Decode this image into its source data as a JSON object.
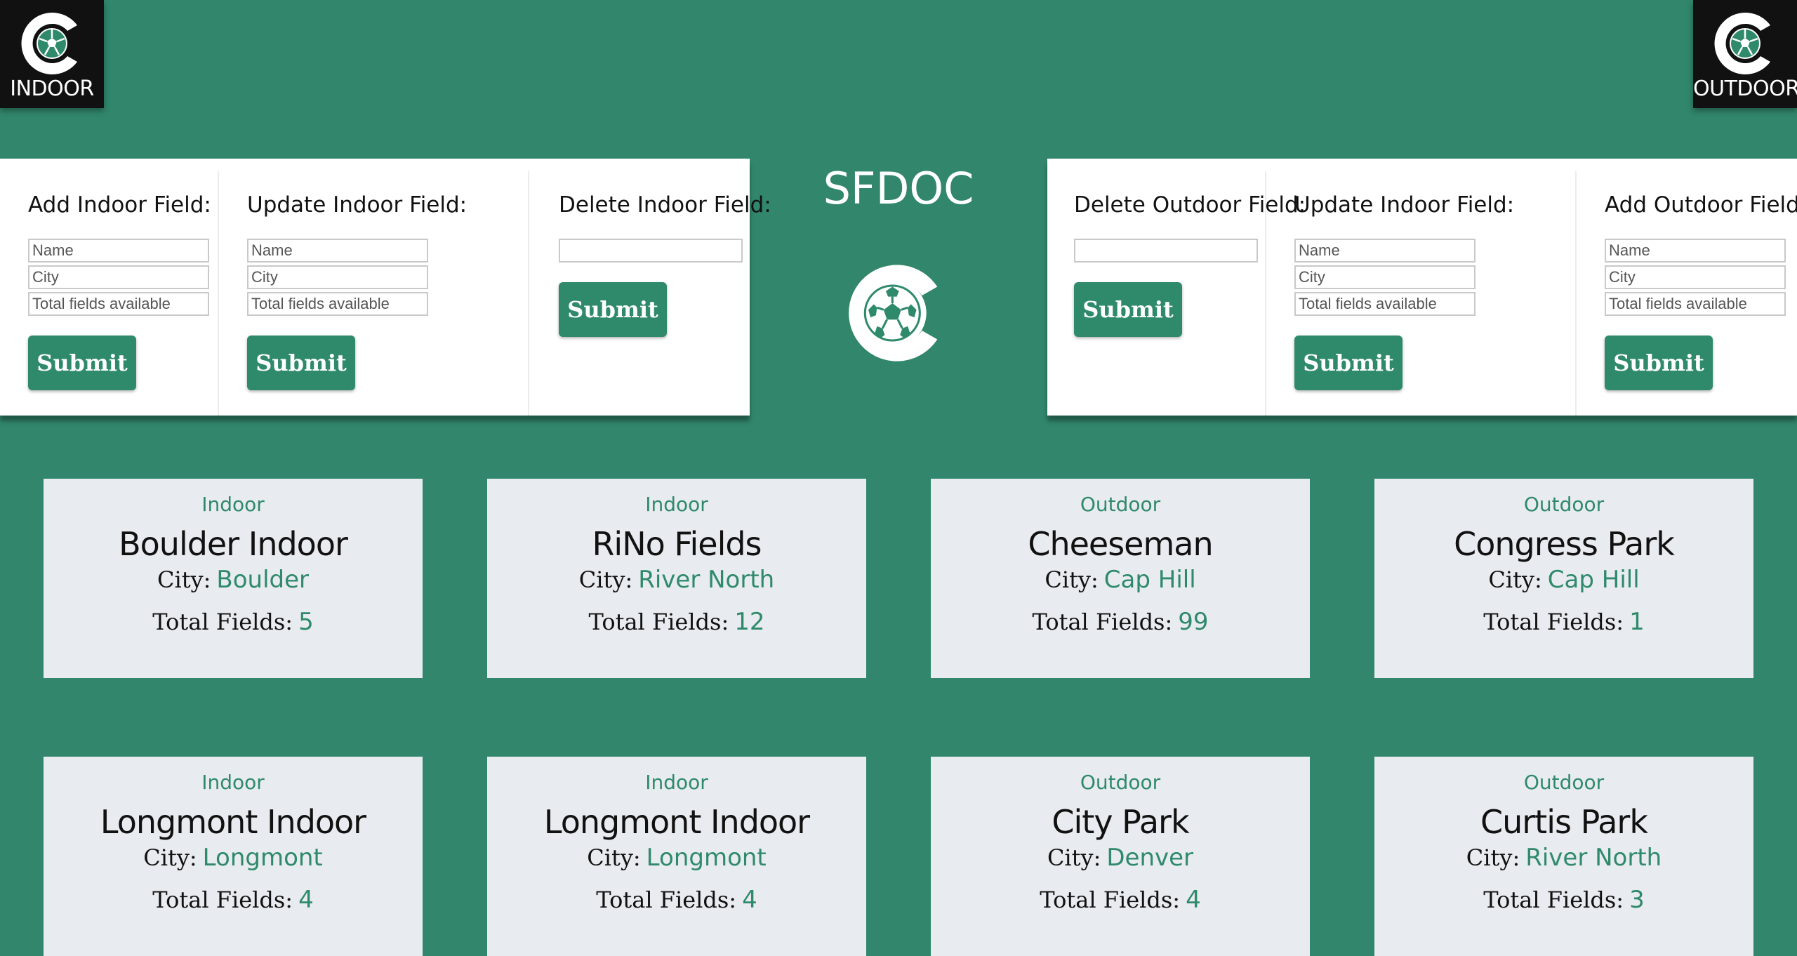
{
  "logos": {
    "left_label": "INDOOR",
    "right_label": "OUTDOOR"
  },
  "brand": {
    "title": "SFDOC"
  },
  "left_forms": [
    {
      "title": "Add Indoor Field:",
      "inputs": [
        "Name",
        "City",
        "Total fields available"
      ],
      "submit": "Submit"
    },
    {
      "title": "Update Indoor Field:",
      "inputs": [
        "Name",
        "City",
        "Total fields available"
      ],
      "submit": "Submit"
    },
    {
      "title": "Delete Indoor Field:",
      "inputs": [
        ""
      ],
      "submit": "Submit"
    }
  ],
  "right_forms": [
    {
      "title": "Delete Outdoor Field:",
      "inputs": [
        ""
      ],
      "submit": "Submit"
    },
    {
      "title": "Update Indoor Field:",
      "inputs": [
        "Name",
        "City",
        "Total fields available"
      ],
      "submit": "Submit"
    },
    {
      "title": "Add Outdoor Field:",
      "inputs": [
        "Name",
        "City",
        "Total fields available"
      ],
      "submit": "Submit"
    }
  ],
  "card_labels": {
    "city": "City:",
    "total": "Total Fields:"
  },
  "cards": [
    {
      "type": "Indoor",
      "name": "Boulder Indoor",
      "city": "Boulder",
      "total": "5"
    },
    {
      "type": "Indoor",
      "name": "RiNo Fields",
      "city": "River North",
      "total": "12"
    },
    {
      "type": "Outdoor",
      "name": "Cheeseman",
      "city": "Cap Hill",
      "total": "99"
    },
    {
      "type": "Outdoor",
      "name": "Congress Park",
      "city": "Cap Hill",
      "total": "1"
    },
    {
      "type": "Indoor",
      "name": "Longmont Indoor",
      "city": "Longmont",
      "total": "4"
    },
    {
      "type": "Indoor",
      "name": "Longmont Indoor",
      "city": "Longmont",
      "total": "4"
    },
    {
      "type": "Outdoor",
      "name": "City Park",
      "city": "Denver",
      "total": "4"
    },
    {
      "type": "Outdoor",
      "name": "Curtis Park",
      "city": "River North",
      "total": "3"
    }
  ],
  "colors": {
    "background": "#31866b",
    "accent": "#2f8a6b",
    "card": "#e8ebef"
  }
}
